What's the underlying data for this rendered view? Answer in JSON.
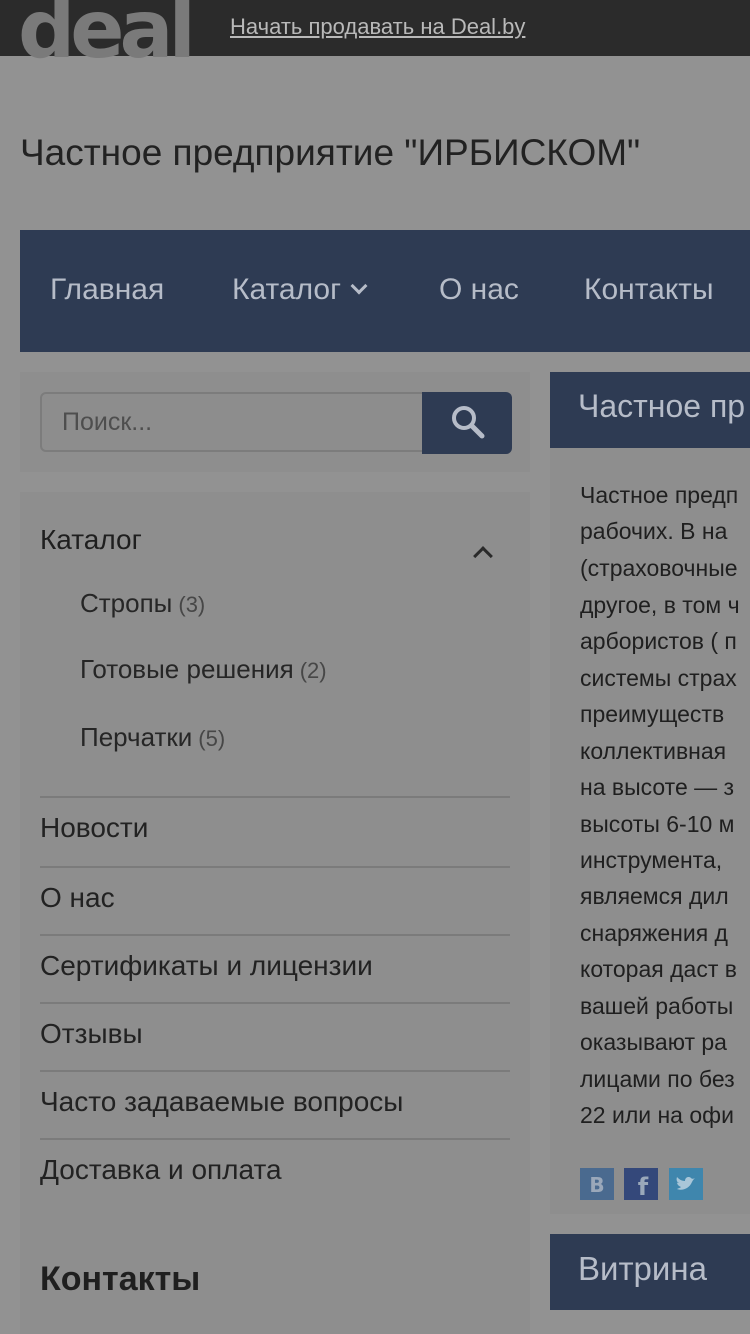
{
  "topbar": {
    "logo": "deal",
    "sell_link": "Начать продавать на Deal.by"
  },
  "company_title": "Частное предприятие \"ИРБИСКОМ\"",
  "nav": [
    {
      "label": "Главная"
    },
    {
      "label": "Каталог"
    },
    {
      "label": "О нас"
    },
    {
      "label": "Контакты"
    }
  ],
  "search": {
    "placeholder": "Поиск...",
    "icon": "search-icon"
  },
  "sidebar": {
    "catalog_label": "Каталог",
    "catalog_items": [
      {
        "label": "Стропы",
        "count": "(3)"
      },
      {
        "label": "Готовые решения",
        "count": "(2)"
      },
      {
        "label": "Перчатки",
        "count": "(5)"
      }
    ],
    "menu": [
      {
        "label": "Новости"
      },
      {
        "label": "О нас"
      },
      {
        "label": "Сертификаты и лицензии"
      },
      {
        "label": "Отзывы"
      },
      {
        "label": "Часто задаваемые вопросы"
      },
      {
        "label": "Доставка и оплата"
      }
    ],
    "contacts_label": "Контакты"
  },
  "main": {
    "title": "Частное пр",
    "text_lines": [
      "Частное предп",
      "рабочих. В на",
      "(страховочные",
      "другое, в том ч",
      "арбористов ( п",
      "системы страх",
      "преимуществ",
      "коллективная",
      "на высоте — з",
      "высоты 6-10 м",
      "инструмента,",
      "являемся дил",
      "снаряжения д",
      "которая даст в",
      "вашей работы",
      "оказывают ра",
      "лицами по без",
      "22 или на офи"
    ],
    "social": [
      {
        "icon": "vk-icon",
        "glyph": "B",
        "color": "#4a6a8f"
      },
      {
        "icon": "facebook-icon",
        "glyph": "f",
        "color": "#34487a"
      },
      {
        "icon": "twitter-icon",
        "glyph": "t",
        "color": "#3f86ad"
      }
    ],
    "showcase_title": "Витрина"
  }
}
